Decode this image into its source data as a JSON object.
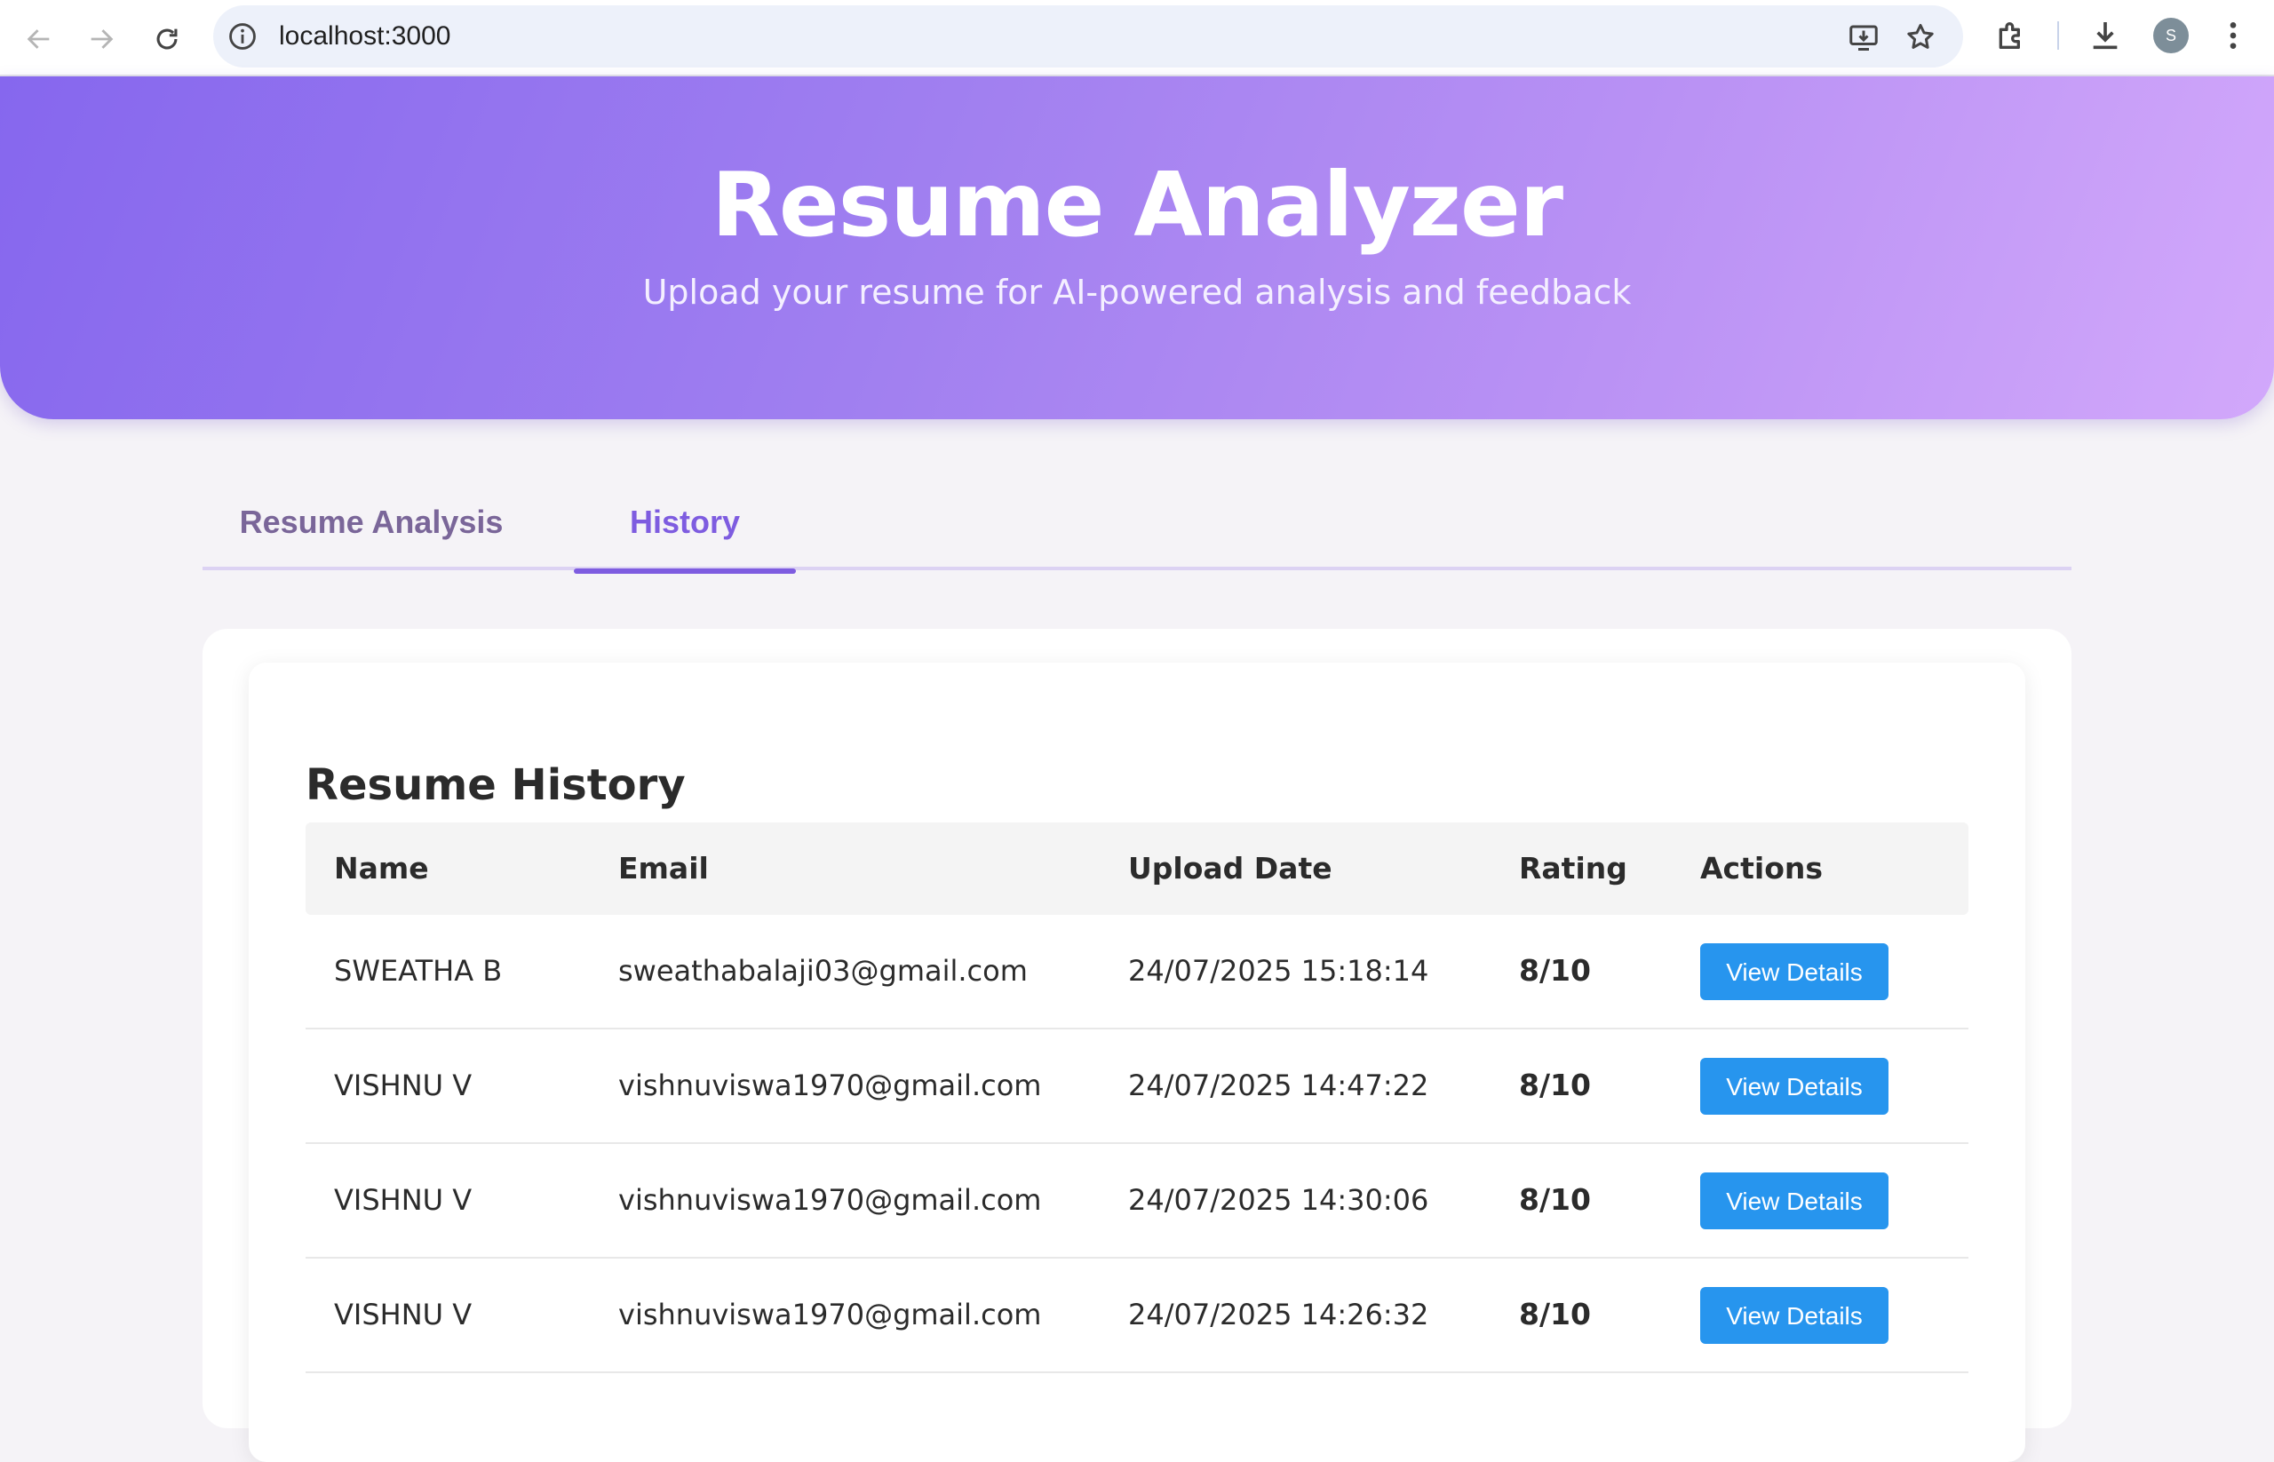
{
  "browser": {
    "url": "localhost:3000",
    "profile_initial": "S"
  },
  "hero": {
    "title": "Resume Analyzer",
    "subtitle": "Upload your resume for AI-powered analysis and feedback"
  },
  "tabs": [
    {
      "label": "Resume Analysis",
      "active": false
    },
    {
      "label": "History",
      "active": true
    }
  ],
  "history": {
    "title": "Resume History",
    "columns": [
      "Name",
      "Email",
      "Upload Date",
      "Rating",
      "Actions"
    ],
    "rows": [
      {
        "name": "SWEATHA B",
        "email": "sweathabalaji03@gmail.com",
        "date": "24/07/2025 15:18:14",
        "rating": "8/10",
        "action": "View Details"
      },
      {
        "name": "VISHNU V",
        "email": "vishnuviswa1970@gmail.com",
        "date": "24/07/2025 14:47:22",
        "rating": "8/10",
        "action": "View Details"
      },
      {
        "name": "VISHNU V",
        "email": "vishnuviswa1970@gmail.com",
        "date": "24/07/2025 14:30:06",
        "rating": "8/10",
        "action": "View Details"
      },
      {
        "name": "VISHNU V",
        "email": "vishnuviswa1970@gmail.com",
        "date": "24/07/2025 14:26:32",
        "rating": "8/10",
        "action": "View Details"
      }
    ]
  },
  "colors": {
    "accent": "#7e5ce0",
    "button": "#2795ee",
    "hero_start": "#8667ee",
    "hero_end": "#d2a8fb"
  }
}
